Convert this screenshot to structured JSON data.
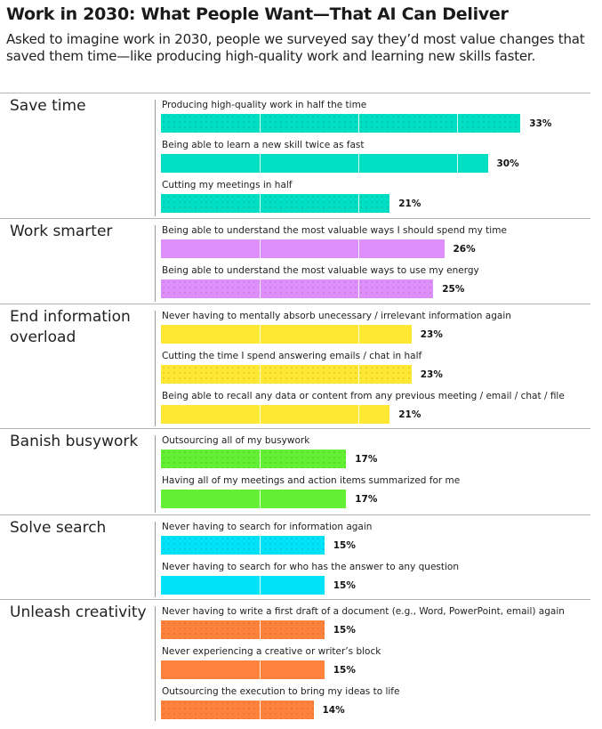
{
  "header": {
    "title": "Work in 2030: What People Want—That AI Can Deliver",
    "subtitle": "Asked to imagine work in 2030, people we surveyed say they’d most value changes that saved them time—like producing high-quality work and learning new skills faster."
  },
  "chart_data": {
    "type": "bar",
    "orientation": "horizontal",
    "title": "Work in 2030: What People Want—That AI Can Deliver",
    "unit": "%",
    "groups": [
      {
        "name": "Save time",
        "color": "#00dfc4",
        "items": [
          {
            "label": "Producing high-quality work in half the time",
            "value": 33,
            "dotted": true
          },
          {
            "label": "Being able to learn a new skill twice as fast",
            "value": 30,
            "dotted": false
          },
          {
            "label": "Cutting my meetings in half",
            "value": 21,
            "dotted": true
          }
        ]
      },
      {
        "name": "Work smarter",
        "color": "#df8ffb",
        "items": [
          {
            "label": "Being able to understand the most valuable ways I should spend my time",
            "value": 26,
            "dotted": false
          },
          {
            "label": "Being able to understand the most valuable ways to use my energy",
            "value": 25,
            "dotted": true
          }
        ]
      },
      {
        "name": "End information overload",
        "color": "#ffe834",
        "items": [
          {
            "label": "Never having to mentally absorb unecessary / irrelevant information again",
            "value": 23,
            "dotted": false
          },
          {
            "label": "Cutting the time I spend answering emails / chat in half",
            "value": 23,
            "dotted": true
          },
          {
            "label": "Being able to recall any data or content from any previous meeting / email / chat / file",
            "value": 21,
            "dotted": false
          }
        ]
      },
      {
        "name": "Banish busywork",
        "color": "#63ef33",
        "items": [
          {
            "label": "Outsourcing all of my busywork",
            "value": 17,
            "dotted": true
          },
          {
            "label": "Having all of my meetings and action items summarized for me",
            "value": 17,
            "dotted": false
          }
        ]
      },
      {
        "name": "Solve search",
        "color": "#00e2f7",
        "items": [
          {
            "label": "Never having to search for information again",
            "value": 15,
            "dotted": true
          },
          {
            "label": "Never having to search for who has the answer to any question",
            "value": 15,
            "dotted": false
          }
        ]
      },
      {
        "name": "Unleash creativity",
        "color": "#ff823c",
        "items": [
          {
            "label": "Never having to write a first draft of a document (e.g., Word, PowerPoint, email) again",
            "value": 15,
            "dotted": true
          },
          {
            "label": "Never experiencing a creative or writer’s block",
            "value": 15,
            "dotted": false
          },
          {
            "label": "Outsourcing the execution to bring my ideas to life",
            "value": 14,
            "dotted": true
          }
        ]
      }
    ]
  }
}
